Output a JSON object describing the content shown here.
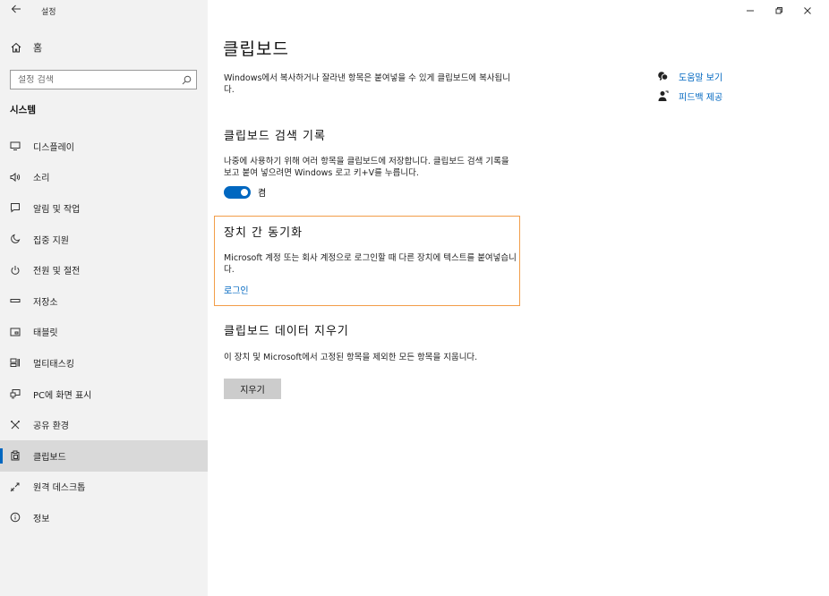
{
  "window": {
    "title": "설정"
  },
  "sidebar": {
    "home_label": "홈",
    "search_placeholder": "설정 검색",
    "section_title": "시스템",
    "items": [
      {
        "label": "디스플레이",
        "icon": "display-icon"
      },
      {
        "label": "소리",
        "icon": "speaker-icon"
      },
      {
        "label": "알림 및 작업",
        "icon": "notification-icon"
      },
      {
        "label": "집중 지원",
        "icon": "moon-icon"
      },
      {
        "label": "전원 및 절전",
        "icon": "power-icon"
      },
      {
        "label": "저장소",
        "icon": "storage-icon"
      },
      {
        "label": "태블릿",
        "icon": "tablet-icon"
      },
      {
        "label": "멀티태스킹",
        "icon": "multitasking-icon"
      },
      {
        "label": "PC에 화면 표시",
        "icon": "project-icon"
      },
      {
        "label": "공유 환경",
        "icon": "shared-experiences-icon"
      },
      {
        "label": "클립보드",
        "icon": "clipboard-icon",
        "selected": true
      },
      {
        "label": "원격 데스크톱",
        "icon": "remote-desktop-icon"
      },
      {
        "label": "정보",
        "icon": "info-icon"
      }
    ]
  },
  "main": {
    "title": "클립보드",
    "intro": "Windows에서 복사하거나 잘라낸 항목은 붙여넣을 수 있게 클립보드에 복사됩니다.",
    "history": {
      "heading": "클립보드 검색 기록",
      "desc": "나중에 사용하기 위해 여러 항목을 클립보드에 저장합니다. 클립보드 검색 기록을 보고 붙여 넣으려면 Windows 로고 키+V를 누릅니다.",
      "toggle_label": "켬",
      "toggle_on": true
    },
    "sync": {
      "heading": "장치 간 동기화",
      "desc": "Microsoft 계정 또는 회사 계정으로 로그인할 때 다른 장치에 텍스트를 붙여넣습니다.",
      "link": "로그인"
    },
    "clear": {
      "heading": "클립보드 데이터 지우기",
      "desc": "이 장치 및 Microsoft에서 고정된 항목을 제외한 모든 항목을 지웁니다.",
      "button": "지우기"
    }
  },
  "help": {
    "get_help": "도움말 보기",
    "feedback": "피드백 제공"
  },
  "colors": {
    "accent": "#0067c0",
    "highlight_border": "#f29d49",
    "sidebar_bg": "#f2f2f2"
  }
}
